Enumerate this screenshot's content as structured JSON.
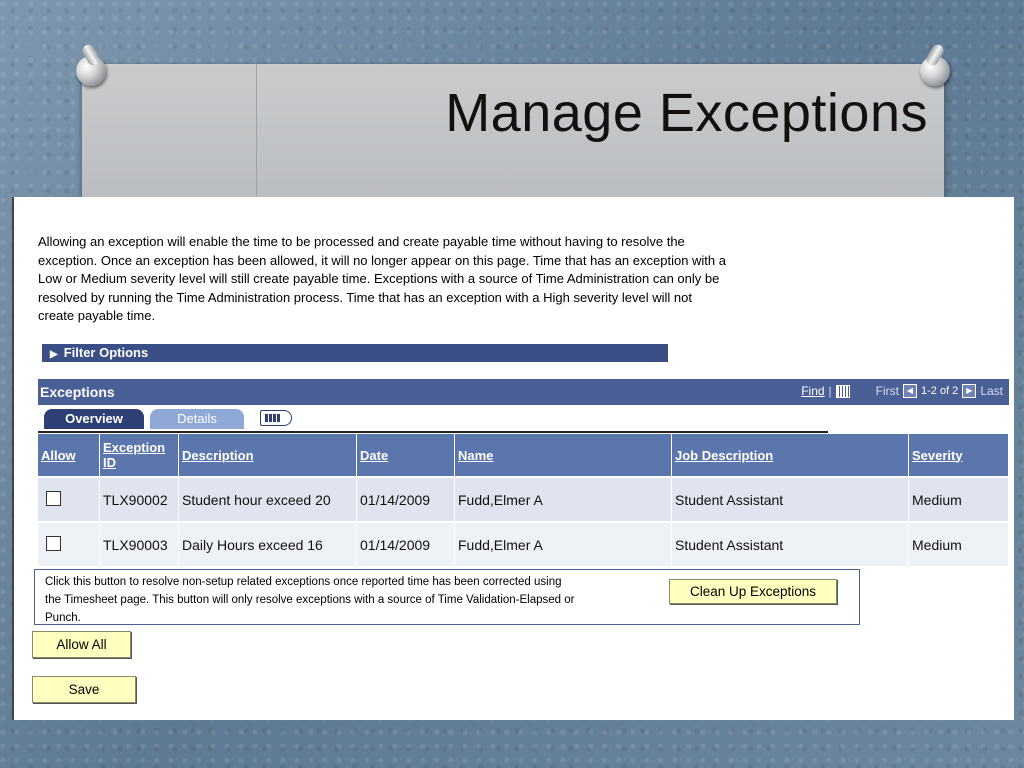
{
  "slide": {
    "title": "Manage Exceptions"
  },
  "intro_text": "Allowing an exception will enable the time to be processed and create payable time without having to resolve the exception.  Once an exception has been allowed, it will no longer appear on this page. Time that has an exception with a Low or Medium severity level will still create payable time. Exceptions with a source of Time Administration can only be resolved by running the Time Administration process. Time that has an exception with a High severity level will not create payable time.",
  "filter": {
    "label": "Filter Options"
  },
  "grid": {
    "title": "Exceptions",
    "find_label": "Find",
    "separator": "|",
    "first_label": "First",
    "range_label": "1-2 of 2",
    "last_label": "Last",
    "tabs": {
      "overview": "Overview",
      "details": "Details"
    },
    "columns": {
      "allow": "Allow",
      "exception_id": "Exception ID",
      "description": "Description",
      "date": "Date",
      "name": "Name",
      "job_description": "Job Description",
      "severity": "Severity"
    },
    "rows": [
      {
        "allow": false,
        "exception_id": "TLX90002",
        "description": "Student hour exceed 20",
        "date": "01/14/2009",
        "name": "Fudd,Elmer A",
        "job_description": "Student Assistant",
        "severity": "Medium"
      },
      {
        "allow": false,
        "exception_id": "TLX90003",
        "description": "Daily Hours exceed 16",
        "date": "01/14/2009",
        "name": "Fudd,Elmer A",
        "job_description": "Student Assistant",
        "severity": "Medium"
      }
    ]
  },
  "cleanup": {
    "text": "Click this button to resolve non-setup related exceptions once reported time has been corrected using the Timesheet page. This button will only resolve exceptions with a source of Time Validation-Elapsed or Punch.",
    "button_label": "Clean Up Exceptions"
  },
  "actions": {
    "allow_all_label": "Allow All",
    "save_label": "Save"
  }
}
